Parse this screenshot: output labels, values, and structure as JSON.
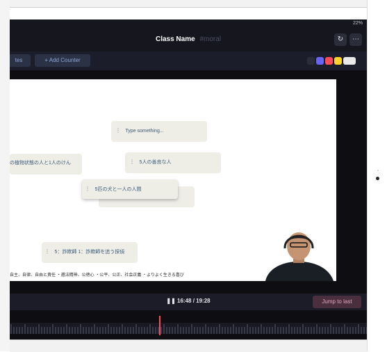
{
  "status": {
    "text": "22%"
  },
  "header": {
    "title": "Class Name",
    "subtitle": "#moral",
    "refresh_icon": "refresh-icon",
    "more_icon": "more-icon"
  },
  "toolbar": {
    "left_button": "tes",
    "add_counter": "+ Add Counter",
    "swatches": [
      "#2b2d3b",
      "#6c63ff",
      "#ff4d5a",
      "#ffd12a",
      "#e9e9e9"
    ]
  },
  "board": {
    "notes": [
      {
        "text": "Type something..."
      },
      {
        "text": "の植物状態の人と1人のけん"
      },
      {
        "text": "5人の善良な人"
      },
      {
        "text": "5匹の犬と一人の人間"
      },
      {
        "text": "5：詐欺師 1：詐欺師を追う探偵"
      }
    ],
    "bottom_text": "自主、自律、自由と責任 ・遵法精神、公徳心 ・公平、公正、社会正義 ・よりよく生きる喜び"
  },
  "player": {
    "time": "16:48 / 19:28",
    "pause_icon": "pause-icon",
    "jump_label": "Jump to last"
  }
}
